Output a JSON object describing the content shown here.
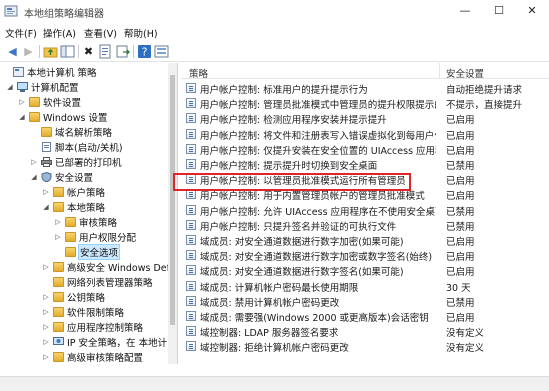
{
  "window": {
    "title": "本地组策略编辑器",
    "minimize": "—",
    "maximize": "☐",
    "close": "✕"
  },
  "menu": [
    "文件(F)",
    "操作(A)",
    "查看(V)",
    "帮助(H)"
  ],
  "toolbar": [
    "back-icon",
    "forward-icon",
    "up-folder-icon",
    "show-tree-icon",
    "delete-icon",
    "properties-icon",
    "export-icon",
    "help-icon",
    "view-icon"
  ],
  "tree": [
    {
      "label": "本地计算机 策略",
      "expanded": true
    },
    {
      "label": "计算机配置",
      "expanded": true
    },
    {
      "label": "软件设置",
      "expanded": false
    },
    {
      "label": "Windows 设置",
      "expanded": true
    },
    {
      "label": "域名解析策略",
      "expanded": null
    },
    {
      "label": "脚本(启动/关机)",
      "expanded": null
    },
    {
      "label": "已部署的打印机",
      "expanded": false
    },
    {
      "label": "安全设置",
      "expanded": true
    },
    {
      "label": "帐户策略",
      "expanded": false
    },
    {
      "label": "本地策略",
      "expanded": true
    },
    {
      "label": "审核策略",
      "expanded": false
    },
    {
      "label": "用户权限分配",
      "expanded": false
    },
    {
      "label": "安全选项",
      "expanded": null,
      "selected": true
    },
    {
      "label": "高级安全 Windows Def",
      "expanded": false
    },
    {
      "label": "网络列表管理器策略",
      "expanded": null
    },
    {
      "label": "公钥策略",
      "expanded": false
    },
    {
      "label": "软件限制策略",
      "expanded": false
    },
    {
      "label": "应用程序控制策略",
      "expanded": false
    },
    {
      "label": "IP 安全策略，在 本地计",
      "expanded": false
    },
    {
      "label": "高级审核策略配置",
      "expanded": false
    }
  ],
  "list": {
    "header_policy": "策略",
    "header_setting": "安全设置",
    "rows": [
      {
        "policy": "用户帐户控制: 标准用户的提升提示行为",
        "setting": "自动拒绝提升请求"
      },
      {
        "policy": "用户帐户控制: 管理员批准模式中管理员的提升权限提示的...",
        "setting": "不提示，直接提升"
      },
      {
        "policy": "用户帐户控制: 检测应用程序安装并提示提升",
        "setting": "已启用"
      },
      {
        "policy": "用户帐户控制: 将文件和注册表写入错误虚拟化到每用户位置",
        "setting": "已启用"
      },
      {
        "policy": "用户帐户控制: 仅提升安装在安全位置的 UIAccess 应用程序",
        "setting": "已启用"
      },
      {
        "policy": "用户帐户控制: 提示提升时切换到安全桌面",
        "setting": "已禁用"
      },
      {
        "policy": "用户帐户控制: 以管理员批准模式运行所有管理员",
        "setting": "已启用",
        "highlighted": true
      },
      {
        "policy": "用户帐户控制: 用于内置管理员帐户的管理员批准模式",
        "setting": "已启用"
      },
      {
        "policy": "用户帐户控制: 允许 UIAccess 应用程序在不使用安全桌面...",
        "setting": "已禁用"
      },
      {
        "policy": "用户帐户控制: 只提升签名并验证的可执行文件",
        "setting": "已禁用"
      },
      {
        "policy": "域成员: 对安全通道数据进行数字加密(如果可能)",
        "setting": "已启用"
      },
      {
        "policy": "域成员: 对安全通道数据进行数字加密或数字签名(始终)",
        "setting": "已启用"
      },
      {
        "policy": "域成员: 对安全通道数据进行数字签名(如果可能)",
        "setting": "已启用"
      },
      {
        "policy": "域成员: 计算机帐户密码最长使用期限",
        "setting": "30 天"
      },
      {
        "policy": "域成员: 禁用计算机帐户密码更改",
        "setting": "已禁用"
      },
      {
        "policy": "域成员: 需要强(Windows 2000 或更高版本)会话密钥",
        "setting": "已启用"
      },
      {
        "policy": "域控制器: LDAP 服务器签名要求",
        "setting": "没有定义"
      },
      {
        "policy": "域控制器: 拒绝计算机帐户密码更改",
        "setting": "没有定义"
      }
    ]
  }
}
